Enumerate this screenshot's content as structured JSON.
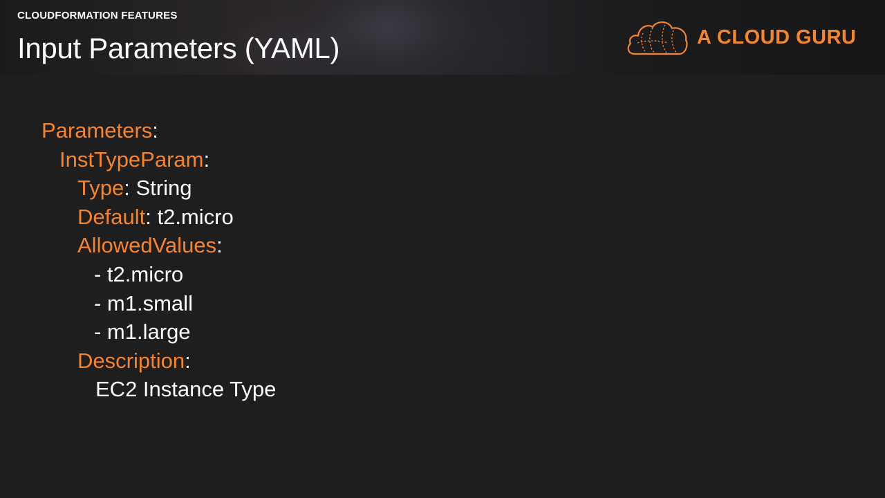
{
  "header": {
    "kicker": "CLOUDFORMATION FEATURES",
    "title": "Input Parameters (YAML)",
    "logo_text": "A CLOUD GURU",
    "logo_icon": "cloud-icon"
  },
  "colors": {
    "accent": "#f5842a",
    "background": "#1e1e1e",
    "text": "#ffffff"
  },
  "code": {
    "parameters_key": "Parameters",
    "param_name": "InstTypeParam",
    "type_key": "Type",
    "type_value": "String",
    "default_key": "Default",
    "default_value": "t2.micro",
    "allowed_key": "AllowedValues",
    "allowed_values": [
      "- t2.micro",
      "- m1.small",
      "- m1.large"
    ],
    "description_key": "Description",
    "description_value": "EC2 Instance Type"
  }
}
